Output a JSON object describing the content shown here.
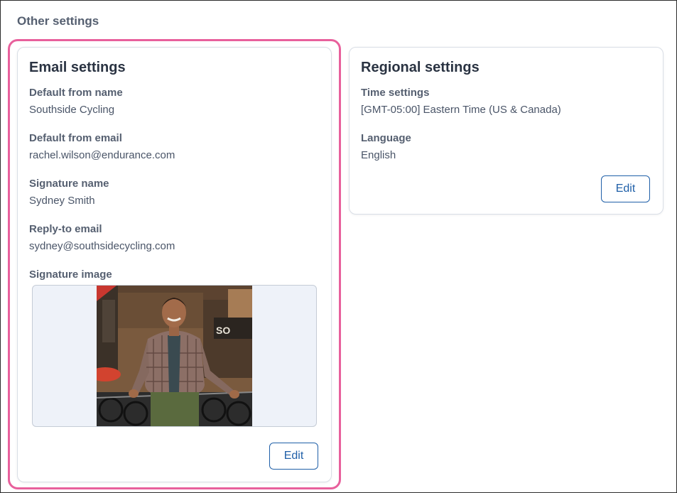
{
  "page": {
    "section_title": "Other settings"
  },
  "email_settings": {
    "title": "Email settings",
    "fields": [
      {
        "label": "Default from name",
        "value": "Southside Cycling"
      },
      {
        "label": "Default from email",
        "value": "rachel.wilson@endurance.com"
      },
      {
        "label": "Signature name",
        "value": "Sydney Smith"
      },
      {
        "label": "Reply-to email",
        "value": "sydney@southsidecycling.com"
      }
    ],
    "signature_image_label": "Signature image",
    "edit_label": "Edit"
  },
  "regional_settings": {
    "title": "Regional settings",
    "fields": [
      {
        "label": "Time settings",
        "value": "[GMT-05:00] Eastern Time (US & Canada)"
      },
      {
        "label": "Language",
        "value": "English"
      }
    ],
    "edit_label": "Edit"
  },
  "colors": {
    "highlight": "#e8609c",
    "button_accent": "#1f5fa8",
    "image_background": "#eef2f9"
  }
}
